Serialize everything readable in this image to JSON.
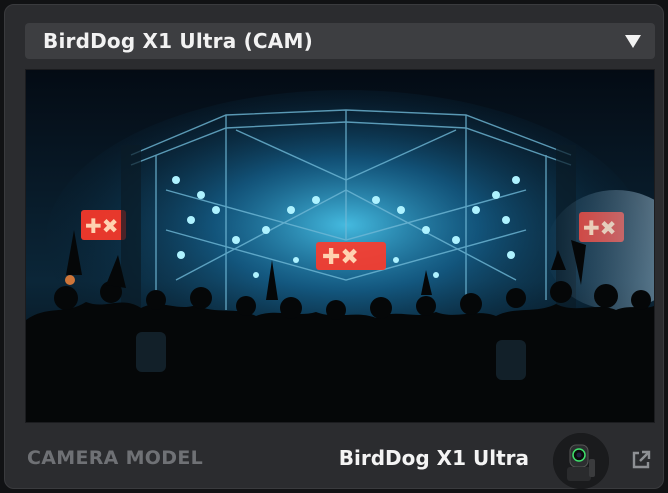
{
  "source": {
    "selected": "BirdDog X1 Ultra (CAM)",
    "dropdown_icon": "triangle-down-icon"
  },
  "preview": {
    "description_icon": "camera-preview"
  },
  "footer": {
    "label": "CAMERA MODEL",
    "value": "BirdDog X1 Ultra",
    "thumbnail_icon": "camera-thumbnail",
    "external_icon": "external-link-icon"
  },
  "colors": {
    "panel": "#2b2c2f",
    "selector": "#3d3e41",
    "label": "#6f7175",
    "text": "#f4f4f4",
    "stage_blue": "#22b8ff",
    "stage_red": "#ff3a2a"
  }
}
